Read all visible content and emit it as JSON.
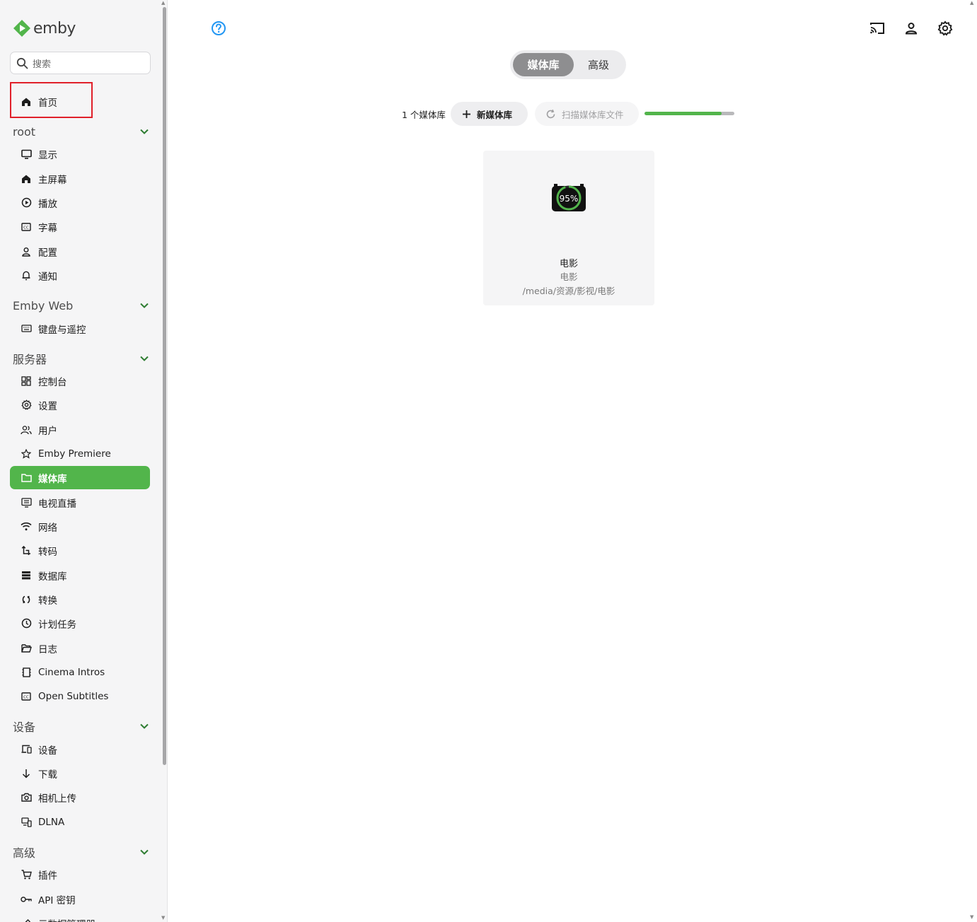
{
  "app": {
    "logo_text": "emby",
    "brand_color": "#52b54b"
  },
  "search": {
    "placeholder": "搜索"
  },
  "nav": {
    "home": "首页",
    "sections": [
      {
        "title": "root",
        "items": [
          "显示",
          "主屏幕",
          "播放",
          "字幕",
          "配置",
          "通知"
        ]
      },
      {
        "title": "Emby Web",
        "items": [
          "键盘与遥控"
        ]
      },
      {
        "title": "服务器",
        "items": [
          "控制台",
          "设置",
          "用户",
          "Emby Premiere",
          "媒体库",
          "电视直播",
          "网络",
          "转码",
          "数据库",
          "转换",
          "计划任务",
          "日志",
          "Cinema Intros",
          "Open Subtitles"
        ]
      },
      {
        "title": "设备",
        "items": [
          "设备",
          "下载",
          "相机上传",
          "DLNA"
        ]
      },
      {
        "title": "高级",
        "items": [
          "插件",
          "API 密钥",
          "元数据管理器"
        ]
      }
    ],
    "active_item": "媒体库"
  },
  "header": {
    "icons": [
      "help-icon",
      "cast-icon",
      "user-icon",
      "settings-icon"
    ]
  },
  "tabs": {
    "libraries": "媒体库",
    "advanced": "高级",
    "selected": "媒体库"
  },
  "toolbar": {
    "count_label": "1 个媒体库",
    "add_label": "新媒体库",
    "scan_label": "扫描媒体库文件",
    "scan_progress": 0.86
  },
  "libraries": [
    {
      "title": "电影",
      "type": "电影",
      "path": "/media/资源/影视/电影",
      "progress_label": "95%"
    }
  ]
}
